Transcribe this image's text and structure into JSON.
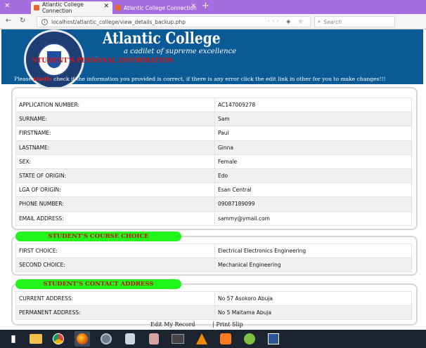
{
  "browser": {
    "tabs": [
      {
        "label": "Atlantic College Connection"
      },
      {
        "label": "Atlantic College Connection"
      }
    ],
    "new_tab": "+",
    "url": "localhost/atlantic_college/view_details_backup.php",
    "search_placeholder": "Search",
    "url_icons": "··· ◈ ☆",
    "colors": {
      "tabbar": "#a56de0",
      "header": "#0a5a95"
    }
  },
  "header": {
    "title": "Atlantic College",
    "tagline": "a cadilet of supreme excellence",
    "logo_text": "Lemoyne Jesuit College",
    "personal_heading": "STUDENT'S PERSONAL INFORMATION",
    "notice_prefix": "Please ",
    "notice_highlight": "kindly",
    "notice_suffix": " check if the information you provided is correct, if there is any error click the edit link in other for you to make changes!!!"
  },
  "personal": [
    {
      "label": "APPLICATION NUMBER:",
      "value": "AC147009278"
    },
    {
      "label": "SURNAME:",
      "value": "Sam"
    },
    {
      "label": "FIRSTNAME:",
      "value": "Paul"
    },
    {
      "label": "LASTNAME:",
      "value": "Ginna"
    },
    {
      "label": "SEX:",
      "value": "Female"
    },
    {
      "label": "STATE OF ORIGIN:",
      "value": "Edo"
    },
    {
      "label": "LGA OF ORIGIN:",
      "value": "Esan Central"
    },
    {
      "label": "PHONE NUMBER:",
      "value": "09087189099"
    },
    {
      "label": "EMAIL ADDRESS:",
      "value": "sammy@ymail.com"
    }
  ],
  "course": {
    "heading": "STUDENT'S COURSE CHOICE",
    "rows": [
      {
        "label": "FIRST CHOICE:",
        "value": "Electrical Electronics Engineering"
      },
      {
        "label": "SECOND CHOICE:",
        "value": "Mechanical Engineering"
      }
    ]
  },
  "contact": {
    "heading": "STUDENT'S CONTACT ADDRESS",
    "rows": [
      {
        "label": "CURRENT ADDRESS:",
        "value": "No 57 Asokoro Abuja"
      },
      {
        "label": "PERMANENT ADDRESS:",
        "value": "No 5 Maitama Abuja"
      }
    ]
  },
  "footer": {
    "edit_label": "Edit My Record",
    "print_label": "| Print Slip"
  },
  "taskbar": {
    "icons": [
      "start-icon",
      "file-explorer-icon",
      "chrome-icon",
      "firefox-icon",
      "settings-icon",
      "database-icon",
      "database2-icon",
      "terminal-icon",
      "vlc-icon",
      "xampp-icon",
      "dreamweaver-icon",
      "word-icon"
    ]
  }
}
